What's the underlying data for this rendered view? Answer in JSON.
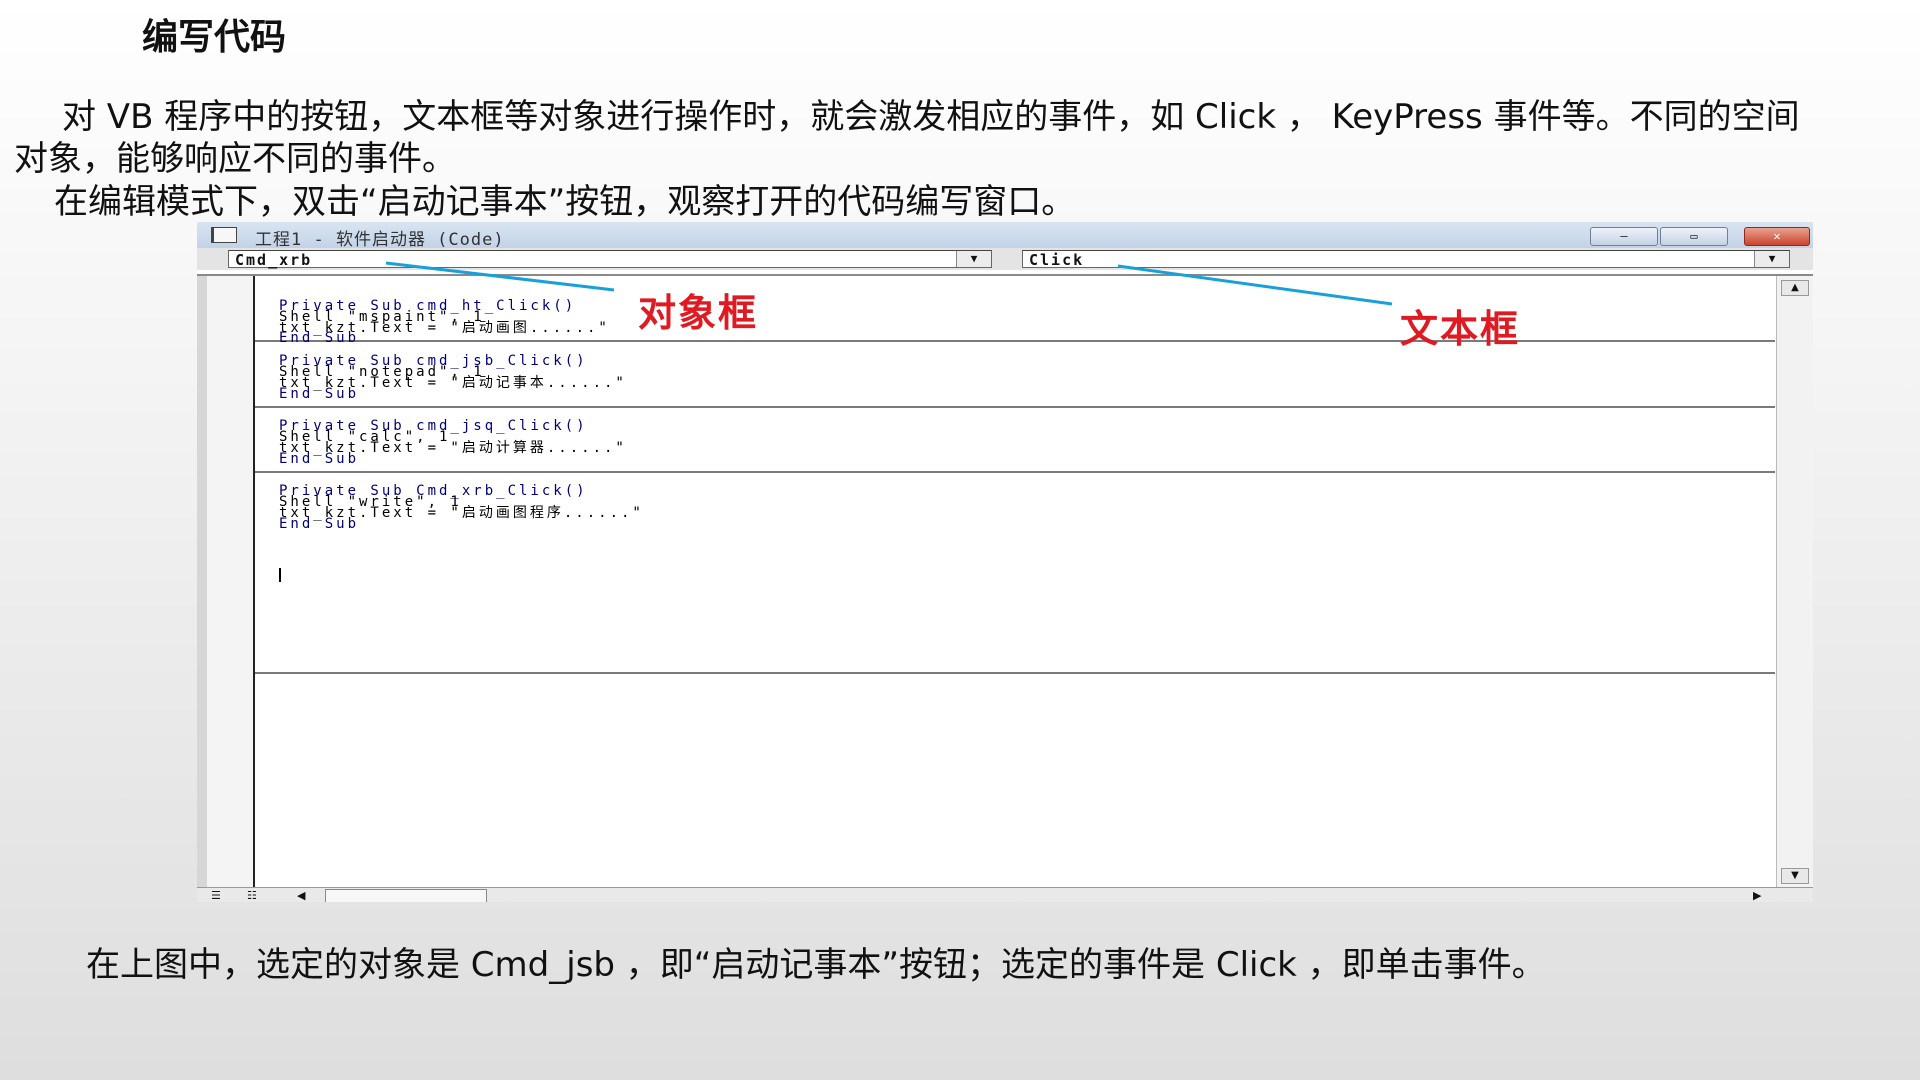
{
  "slide": {
    "title": "编写代码",
    "paragraph1_line1": "对 VB 程序中的按钮，文本框等对象进行操作时，就会激发相应的事件，如 Click ， KeyPress 事件等。不同的空间",
    "paragraph1_line2": "对象，能够响应不同的事件。",
    "paragraph2": "在编辑模式下，双击“启动记事本”按钮，观察打开的代码编写窗口。",
    "caption": "在上图中，选定的对象是 Cmd_jsb ，即“启动记事本”按钮；选定的事件是 Click ，即单击事件。"
  },
  "vb_window": {
    "title": "工程1 - 软件启动器 (Code)",
    "object_combo": "Cmd_xrb",
    "procedure_combo": "Click",
    "procedures": [
      {
        "header": "Private Sub cmd_ht_Click()",
        "line1": "Shell \"mspaint\", 1",
        "line2": "txt_kzt.Text = \"启动画图......\"",
        "footer": "End Sub"
      },
      {
        "header": "Private Sub cmd_jsb_Click()",
        "line1": "Shell \"notepad\", 1",
        "line2": "txt_kzt.Text = \"启动记事本......\"",
        "footer": "End Sub"
      },
      {
        "header": "Private Sub cmd_jsq_Click()",
        "line1": "Shell \"calc\", 1",
        "line2": "txt_kzt.Text = \"启动计算器......\"",
        "footer": "End Sub"
      },
      {
        "header": "Private Sub Cmd_xrb_Click()",
        "line1": "Shell \"write\", 1",
        "line2": "txt_kzt.Text = \"启动画图程序......\"",
        "footer": "End Sub"
      }
    ]
  },
  "annotations": {
    "object_box_label": "对象框",
    "text_box_label": "文本框",
    "color": "#e01a22",
    "line_color": "#1aa0d8"
  },
  "icons": {
    "window_icon": "code-window-icon",
    "minimize": "minimize-icon",
    "maximize": "maximize-icon",
    "close": "close-icon",
    "dropdown": "chevron-down-icon"
  }
}
